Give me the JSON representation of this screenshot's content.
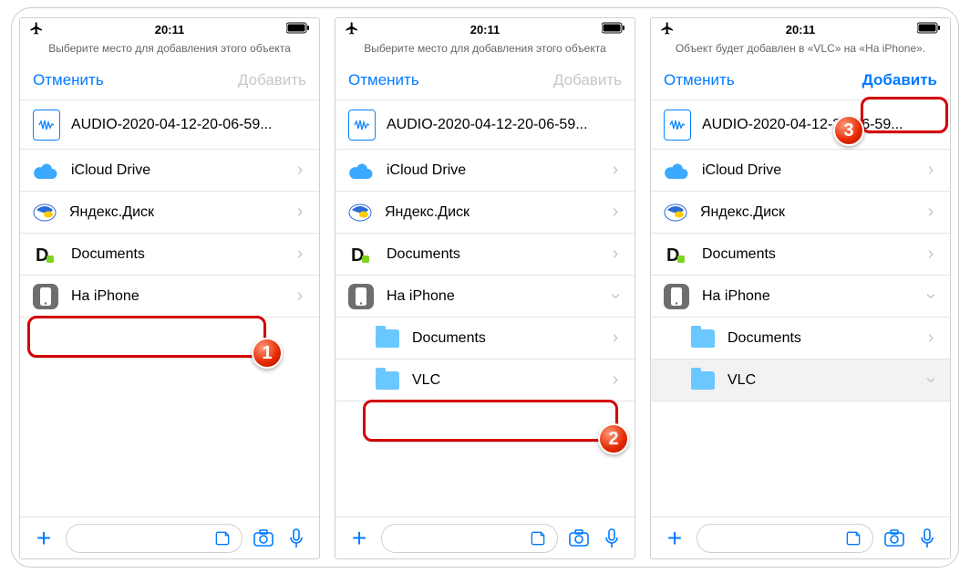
{
  "status": {
    "time": "20:11"
  },
  "screens": [
    {
      "instruction": "Выберите место для добавления этого объекта",
      "cancel": "Отменить",
      "add": "Добавить",
      "add_enabled": false,
      "file": "AUDIO-2020-04-12-20-06-59...",
      "rows": [
        {
          "kind": "icloud",
          "label": "iCloud Drive",
          "chev": "right"
        },
        {
          "kind": "yandex",
          "label": "Яндекс.Диск",
          "chev": "right"
        },
        {
          "kind": "docs",
          "label": "Documents",
          "chev": "right"
        },
        {
          "kind": "oniphone",
          "label": "На iPhone",
          "chev": "right"
        }
      ],
      "highlight_row_index": 3,
      "badge": "1"
    },
    {
      "instruction": "Выберите место для добавления этого объекта",
      "cancel": "Отменить",
      "add": "Добавить",
      "add_enabled": false,
      "file": "AUDIO-2020-04-12-20-06-59...",
      "rows": [
        {
          "kind": "icloud",
          "label": "iCloud Drive",
          "chev": "right"
        },
        {
          "kind": "yandex",
          "label": "Яндекс.Диск",
          "chev": "right"
        },
        {
          "kind": "docs",
          "label": "Documents",
          "chev": "right"
        },
        {
          "kind": "oniphone",
          "label": "На iPhone",
          "chev": "down"
        },
        {
          "kind": "folder",
          "label": "Documents",
          "chev": "right",
          "sub": true
        },
        {
          "kind": "folder",
          "label": "VLC",
          "chev": "right",
          "sub": true
        }
      ],
      "highlight_row_index": 5,
      "badge": "2"
    },
    {
      "instruction": "Объект будет добавлен в «VLC» на «На iPhone».",
      "cancel": "Отменить",
      "add": "Добавить",
      "add_enabled": true,
      "file": "AUDIO-2020-04-12-20-06-59...",
      "rows": [
        {
          "kind": "icloud",
          "label": "iCloud Drive",
          "chev": "right"
        },
        {
          "kind": "yandex",
          "label": "Яндекс.Диск",
          "chev": "right"
        },
        {
          "kind": "docs",
          "label": "Documents",
          "chev": "right"
        },
        {
          "kind": "oniphone",
          "label": "На iPhone",
          "chev": "down"
        },
        {
          "kind": "folder",
          "label": "Documents",
          "chev": "right",
          "sub": true
        },
        {
          "kind": "folder",
          "label": "VLC",
          "chev": "down",
          "sub": true,
          "selected": true
        }
      ],
      "highlight_add": true,
      "badge": "3"
    }
  ]
}
